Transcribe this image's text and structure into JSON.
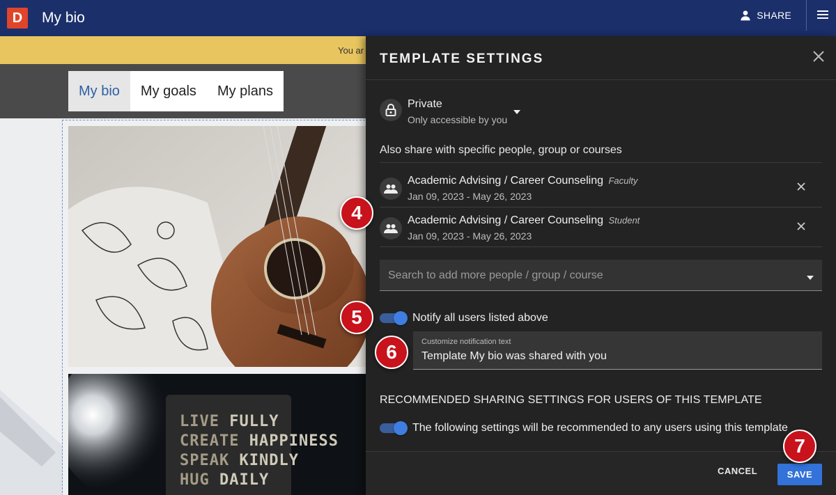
{
  "topbar": {
    "logo_letter": "D",
    "title": "My bio",
    "share_label": "SHARE"
  },
  "background_page": {
    "notice_text": "You ar",
    "nav_tabs": [
      {
        "label": "My bio",
        "active": true
      },
      {
        "label": "My goals",
        "active": false
      },
      {
        "label": "My plans",
        "active": false
      }
    ],
    "poster_lines": [
      {
        "dim": "LIVE",
        "bright": "FULLY"
      },
      {
        "dim": "CREATE",
        "bright": "HAPPINESS"
      },
      {
        "dim": "SPEAK",
        "bright": "KINDLY"
      },
      {
        "dim": "HUG",
        "bright": "DAILY"
      }
    ]
  },
  "drawer": {
    "title": "TEMPLATE SETTINGS",
    "privacy": {
      "label": "Private",
      "sublabel": "Only accessible by you"
    },
    "also_share_label": "Also share with specific people, group or courses",
    "shared_with": [
      {
        "name": "Academic Advising / Career Counseling",
        "role": "Faculty",
        "dates": "Jan 09, 2023 - May 26, 2023"
      },
      {
        "name": "Academic Advising / Career Counseling",
        "role": "Student",
        "dates": "Jan 09, 2023 - May 26, 2023"
      }
    ],
    "search_placeholder": "Search to add more people / group / course",
    "notify": {
      "label": "Notify all users listed above",
      "enabled": true
    },
    "notification_text": {
      "label": "Customize notification text",
      "value": "Template My bio was shared with you"
    },
    "recommended_heading": "RECOMMENDED SHARING SETTINGS FOR USERS OF THIS TEMPLATE",
    "recommend_toggle": {
      "label": "The following settings will be recommended to any users using this template",
      "enabled": true
    },
    "cancel_label": "CANCEL",
    "save_label": "SAVE"
  },
  "step_badges": [
    "4",
    "5",
    "6",
    "7"
  ],
  "colors": {
    "topbar": "#1b2f6b",
    "logo": "#e0452b",
    "drawer_bg": "#232323",
    "accent_blue": "#3272d9",
    "badge_red": "#c8121c",
    "notice_yellow": "#e8c55e"
  }
}
